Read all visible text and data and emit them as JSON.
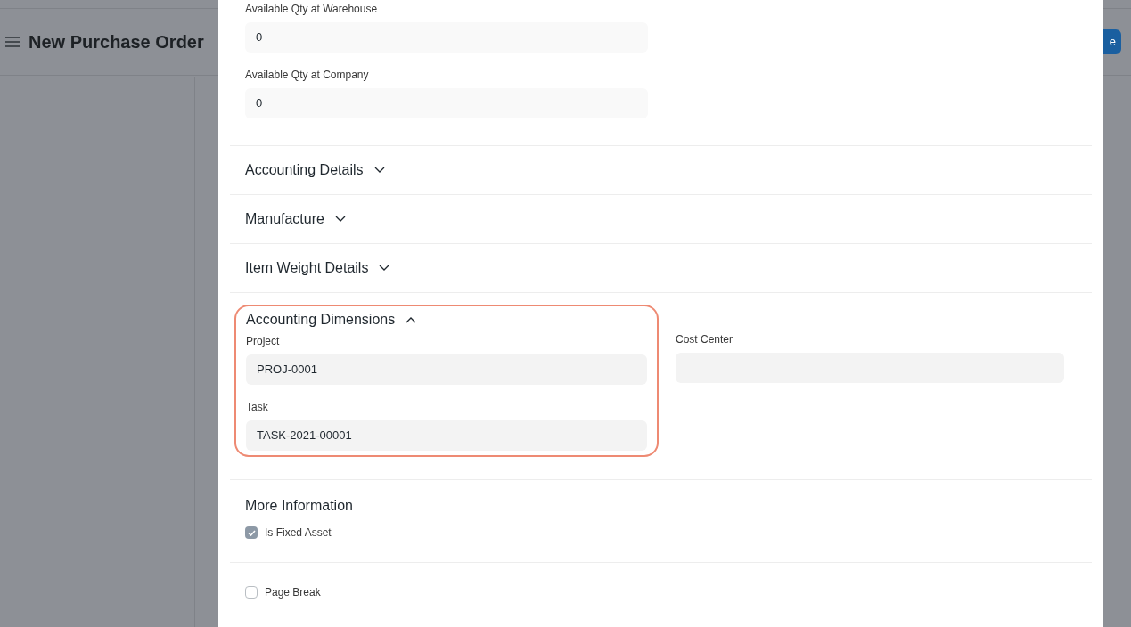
{
  "page": {
    "title": "New Purchase Order",
    "button": "e"
  },
  "top_fields": [
    {
      "label": "Available Qty at Warehouse",
      "value": "0"
    },
    {
      "label": "Available Qty at Company",
      "value": "0"
    }
  ],
  "sections": [
    {
      "title": "Accounting Details",
      "expanded": false
    },
    {
      "title": "Manufacture",
      "expanded": false
    },
    {
      "title": "Item Weight Details",
      "expanded": false
    }
  ],
  "dimensions": {
    "title": "Accounting Dimensions",
    "expanded": true,
    "highlighted": true,
    "left_fields": [
      {
        "label": "Project",
        "value": "PROJ-0001"
      },
      {
        "label": "Task",
        "value": "TASK-2021-00001"
      }
    ],
    "right_fields": [
      {
        "label": "Cost Center"
      }
    ]
  },
  "more_information": {
    "title": "More Information",
    "checkboxes": [
      {
        "label": "Is Fixed Asset",
        "checked": true
      }
    ]
  },
  "bottom_checkboxes": [
    {
      "label": "Page Break",
      "checked": false
    }
  ]
}
